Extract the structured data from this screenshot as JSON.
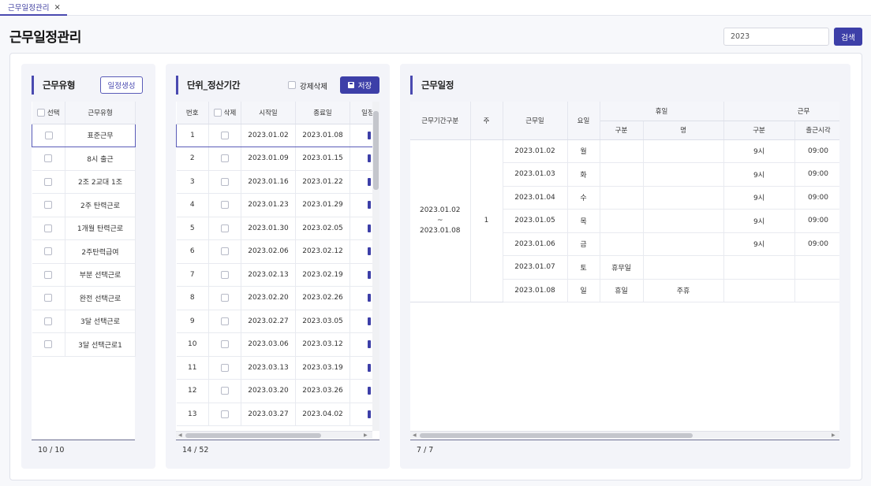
{
  "tab": {
    "label": "근무일정관리",
    "close": "×"
  },
  "page_title": "근무일정관리",
  "search": {
    "value": "2023",
    "button": "검색"
  },
  "work_type": {
    "title": "근무유형",
    "button": "일정생성",
    "headers": [
      "선택",
      "근무유형"
    ],
    "rows": [
      "표준근무",
      "8시 출근",
      "2조 2교대 1조",
      "2주 탄력근로",
      "1개월 탄력근로",
      "2주탄력급여",
      "부분 선택근로",
      "완전 선택근로",
      "3달 선택근로",
      "3달 선택근로1"
    ],
    "count": "10 / 10"
  },
  "period": {
    "title": "단위_정산기간",
    "force_delete_label": "강제삭제",
    "save_button": "저장",
    "headers": [
      "번호",
      "삭제",
      "시작일",
      "종료일",
      "일정"
    ],
    "rows": [
      {
        "no": "1",
        "start": "2023.01.02",
        "end": "2023.01.08"
      },
      {
        "no": "2",
        "start": "2023.01.09",
        "end": "2023.01.15"
      },
      {
        "no": "3",
        "start": "2023.01.16",
        "end": "2023.01.22"
      },
      {
        "no": "4",
        "start": "2023.01.23",
        "end": "2023.01.29"
      },
      {
        "no": "5",
        "start": "2023.01.30",
        "end": "2023.02.05"
      },
      {
        "no": "6",
        "start": "2023.02.06",
        "end": "2023.02.12"
      },
      {
        "no": "7",
        "start": "2023.02.13",
        "end": "2023.02.19"
      },
      {
        "no": "8",
        "start": "2023.02.20",
        "end": "2023.02.26"
      },
      {
        "no": "9",
        "start": "2023.02.27",
        "end": "2023.03.05"
      },
      {
        "no": "10",
        "start": "2023.03.06",
        "end": "2023.03.12"
      },
      {
        "no": "11",
        "start": "2023.03.13",
        "end": "2023.03.19"
      },
      {
        "no": "12",
        "start": "2023.03.20",
        "end": "2023.03.26"
      },
      {
        "no": "13",
        "start": "2023.03.27",
        "end": "2023.04.02"
      }
    ],
    "count": "14 / 52"
  },
  "schedule": {
    "title": "근무일정",
    "headers": {
      "period": "근무기간구분",
      "week": "주",
      "date": "근무일",
      "day": "요일",
      "holiday": "휴일",
      "holiday_type": "구분",
      "holiday_name": "명",
      "work": "근무",
      "work_type": "구분",
      "start_time": "출근시각"
    },
    "period_start": "2023.01.02",
    "period_sep": "~",
    "period_end": "2023.01.08",
    "week": "1",
    "rows": [
      {
        "date": "2023.01.02",
        "day": "월",
        "h_type": "",
        "h_name": "",
        "w_type": "9시",
        "start": "09:00"
      },
      {
        "date": "2023.01.03",
        "day": "화",
        "h_type": "",
        "h_name": "",
        "w_type": "9시",
        "start": "09:00"
      },
      {
        "date": "2023.01.04",
        "day": "수",
        "h_type": "",
        "h_name": "",
        "w_type": "9시",
        "start": "09:00"
      },
      {
        "date": "2023.01.05",
        "day": "목",
        "h_type": "",
        "h_name": "",
        "w_type": "9시",
        "start": "09:00"
      },
      {
        "date": "2023.01.06",
        "day": "금",
        "h_type": "",
        "h_name": "",
        "w_type": "9시",
        "start": "09:00"
      },
      {
        "date": "2023.01.07",
        "day": "토",
        "h_type": "휴무일",
        "h_name": "",
        "w_type": "",
        "start": ""
      },
      {
        "date": "2023.01.08",
        "day": "일",
        "h_type": "휴일",
        "h_name": "주휴",
        "w_type": "",
        "start": ""
      }
    ],
    "count": "7 / 7"
  }
}
